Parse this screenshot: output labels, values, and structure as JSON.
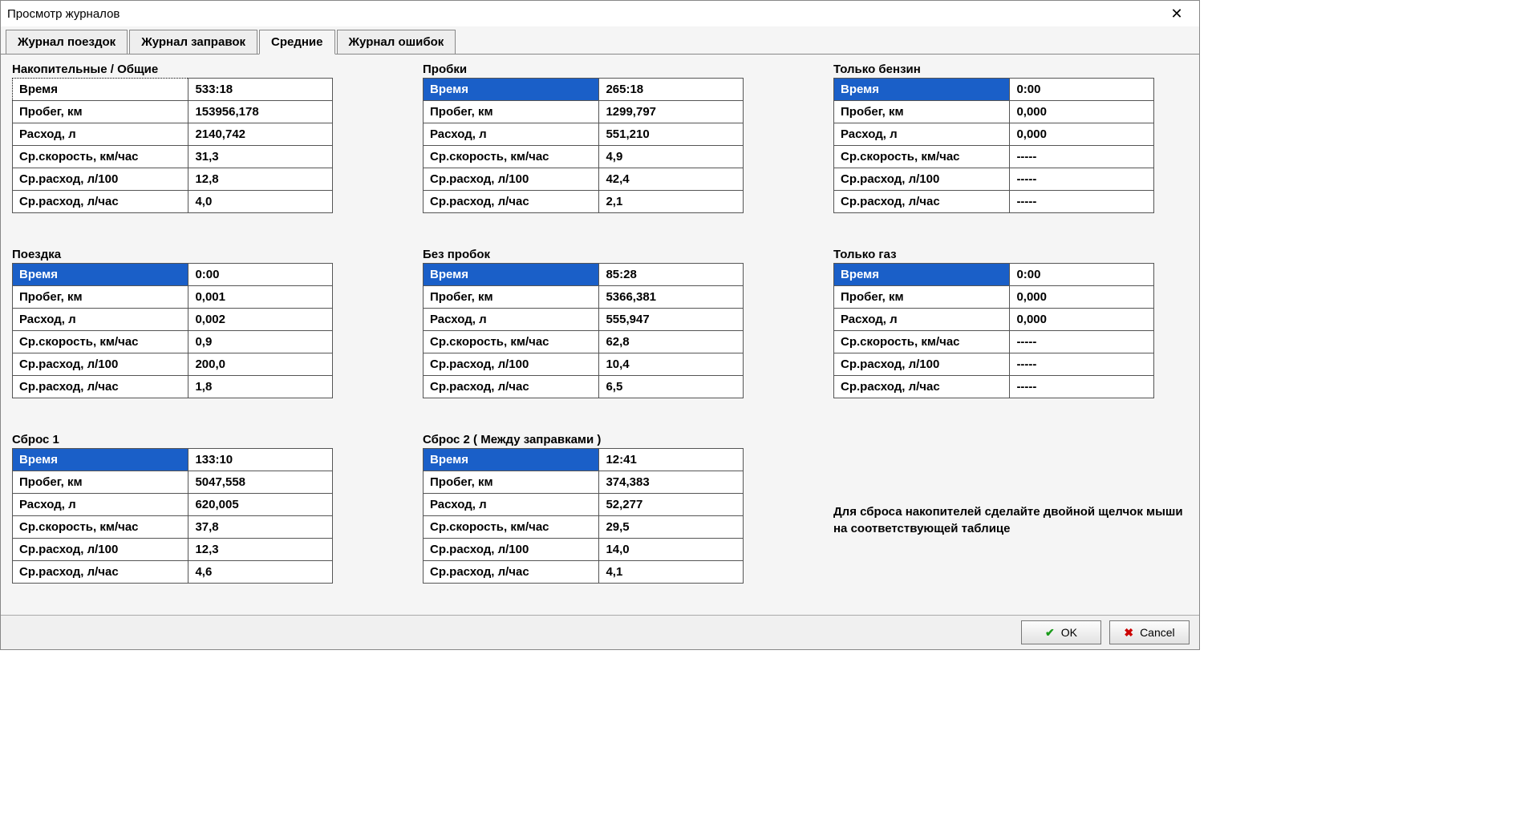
{
  "window": {
    "title": "Просмотр журналов"
  },
  "tabs": [
    {
      "label": "Журнал поездок",
      "active": false
    },
    {
      "label": "Журнал заправок",
      "active": false
    },
    {
      "label": "Средние",
      "active": true
    },
    {
      "label": "Журнал ошибок",
      "active": false
    }
  ],
  "row_labels": {
    "time": "Время",
    "mileage": "Пробег, км",
    "consumption": "Расход, л",
    "avg_speed": "Ср.скорость, км/час",
    "avg_cons_100": "Ср.расход, л/100",
    "avg_cons_hour": "Ср.расход, л/час"
  },
  "blocks": {
    "cumulative": {
      "title": "Накопительные / Общие",
      "focused": true,
      "values": {
        "time": "533:18",
        "mileage": "153956,178",
        "consumption": "2140,742",
        "avg_speed": "31,3",
        "avg_cons_100": "12,8",
        "avg_cons_hour": "4,0"
      }
    },
    "traffic": {
      "title": "Пробки",
      "values": {
        "time": "265:18",
        "mileage": "1299,797",
        "consumption": "551,210",
        "avg_speed": "4,9",
        "avg_cons_100": "42,4",
        "avg_cons_hour": "2,1"
      }
    },
    "petrol": {
      "title": "Только бензин",
      "values": {
        "time": "0:00",
        "mileage": "0,000",
        "consumption": "0,000",
        "avg_speed": "-----",
        "avg_cons_100": "-----",
        "avg_cons_hour": "-----"
      }
    },
    "trip": {
      "title": "Поездка",
      "values": {
        "time": "0:00",
        "mileage": "0,001",
        "consumption": "0,002",
        "avg_speed": "0,9",
        "avg_cons_100": "200,0",
        "avg_cons_hour": "1,8"
      }
    },
    "no_traffic": {
      "title": "Без пробок",
      "values": {
        "time": "85:28",
        "mileage": "5366,381",
        "consumption": "555,947",
        "avg_speed": "62,8",
        "avg_cons_100": "10,4",
        "avg_cons_hour": "6,5"
      }
    },
    "gas": {
      "title": "Только газ",
      "values": {
        "time": "0:00",
        "mileage": "0,000",
        "consumption": "0,000",
        "avg_speed": "-----",
        "avg_cons_100": "-----",
        "avg_cons_hour": "-----"
      }
    },
    "reset1": {
      "title": "Сброс 1",
      "values": {
        "time": "133:10",
        "mileage": "5047,558",
        "consumption": "620,005",
        "avg_speed": "37,8",
        "avg_cons_100": "12,3",
        "avg_cons_hour": "4,6"
      }
    },
    "reset2": {
      "title": "Сброс 2 ( Между заправками )",
      "values": {
        "time": "12:41",
        "mileage": "374,383",
        "consumption": "52,277",
        "avg_speed": "29,5",
        "avg_cons_100": "14,0",
        "avg_cons_hour": "4,1"
      }
    }
  },
  "hint": "Для сброса накопителей сделайте двойной щелчок мыши на соответствующей таблице",
  "buttons": {
    "ok": "OK",
    "cancel": "Cancel"
  }
}
